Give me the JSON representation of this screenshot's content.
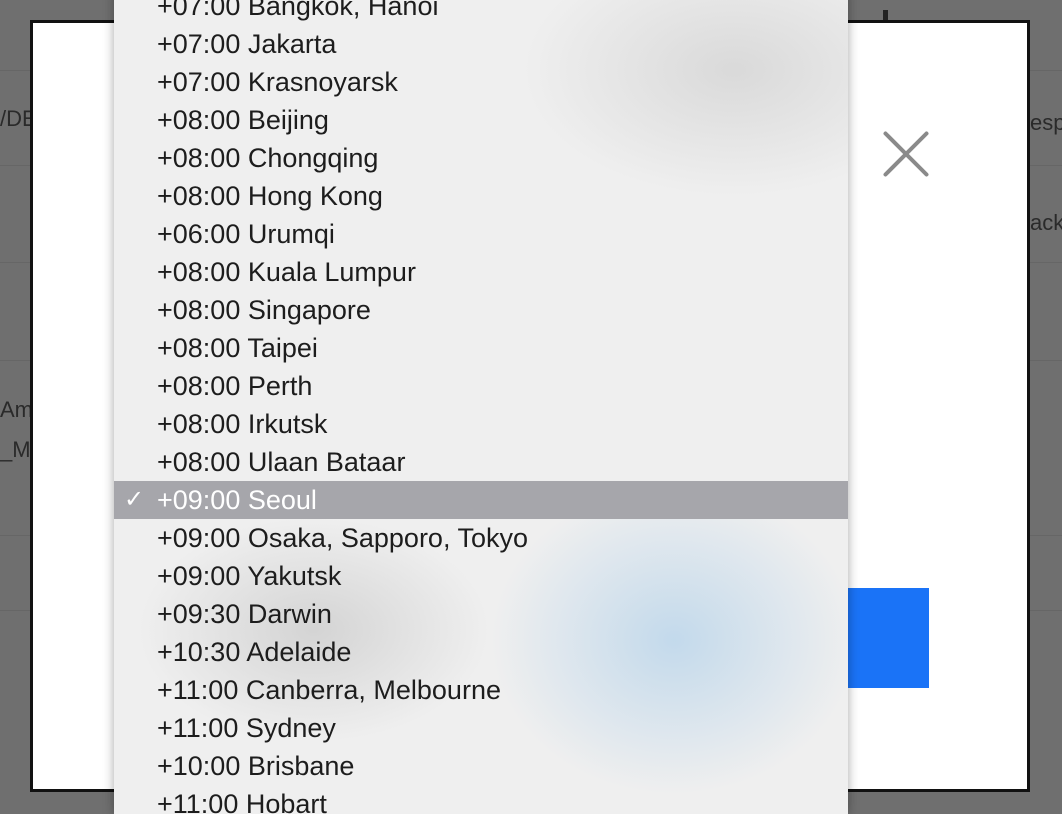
{
  "background_page": {
    "fragments": [
      "/DE",
      "esp",
      "ack",
      "Am",
      "_M"
    ]
  },
  "modal": {
    "close_icon": "close-icon"
  },
  "timezone_menu": {
    "selected_check": "✓",
    "items": [
      {
        "label": "+07:00 Bangkok, Hanoi",
        "selected": false
      },
      {
        "label": "+07:00 Jakarta",
        "selected": false
      },
      {
        "label": "+07:00 Krasnoyarsk",
        "selected": false
      },
      {
        "label": "+08:00 Beijing",
        "selected": false
      },
      {
        "label": "+08:00 Chongqing",
        "selected": false
      },
      {
        "label": "+08:00 Hong Kong",
        "selected": false
      },
      {
        "label": "+06:00 Urumqi",
        "selected": false
      },
      {
        "label": "+08:00 Kuala Lumpur",
        "selected": false
      },
      {
        "label": "+08:00 Singapore",
        "selected": false
      },
      {
        "label": "+08:00 Taipei",
        "selected": false
      },
      {
        "label": "+08:00 Perth",
        "selected": false
      },
      {
        "label": "+08:00 Irkutsk",
        "selected": false
      },
      {
        "label": "+08:00 Ulaan Bataar",
        "selected": false
      },
      {
        "label": "+09:00 Seoul",
        "selected": true
      },
      {
        "label": "+09:00 Osaka, Sapporo, Tokyo",
        "selected": false
      },
      {
        "label": "+09:00 Yakutsk",
        "selected": false
      },
      {
        "label": "+09:30 Darwin",
        "selected": false
      },
      {
        "label": "+10:30 Adelaide",
        "selected": false
      },
      {
        "label": "+11:00 Canberra, Melbourne",
        "selected": false
      },
      {
        "label": "+11:00 Sydney",
        "selected": false
      },
      {
        "label": "+10:00 Brisbane",
        "selected": false
      },
      {
        "label": "+11:00 Hobart",
        "selected": false
      }
    ]
  }
}
